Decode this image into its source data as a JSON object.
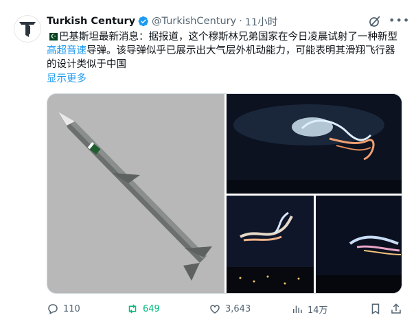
{
  "account": {
    "name": "Turkish Century",
    "handle": "@TurkishCentury",
    "separator": "·",
    "time": "11小时"
  },
  "tweet": {
    "text_before": "巴基斯坦最新消息：据报道，这个穆斯林兄弟国家在今日凌晨试射了一种新型",
    "link_text": "高超音速",
    "text_after": "导弹。该导弹似乎已展示出大气层外机动能力，可能表明其滑翔飞行器的设计类似于中国",
    "show_more": "显示更多"
  },
  "colors": {
    "link": "#1d9bf0",
    "retweet": "#00ba7c",
    "verified": "#1d9bf0",
    "muted": "#536471"
  },
  "actions": {
    "replies": "110",
    "reposts": "649",
    "likes": "3,643",
    "views": "14万"
  },
  "icons": [
    "verified-badge-icon",
    "grok-icon",
    "more-icon",
    "reply-icon",
    "retweet-icon",
    "like-icon",
    "views-icon",
    "bookmark-icon",
    "share-icon"
  ]
}
